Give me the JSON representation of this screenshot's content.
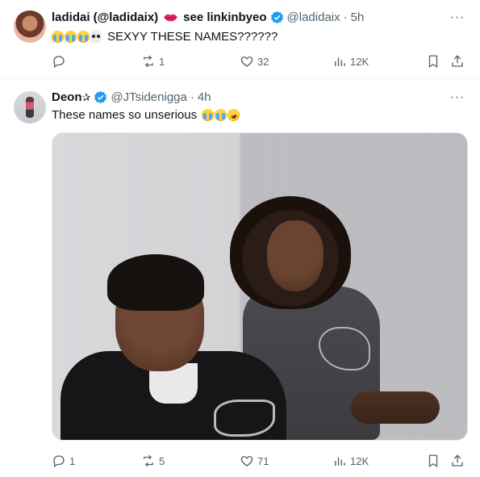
{
  "tweet1": {
    "display_name": "ladidai (@ladidaix)",
    "extra_name": "see linkinbyeo",
    "handle": "@ladidaix",
    "separator": "·",
    "time": "5h",
    "text": "SEXYY THESE NAMES??????",
    "emojis": [
      "crying-face",
      "crying-face",
      "crying-face",
      "skull"
    ],
    "more_label": "···",
    "actions": {
      "replies": "",
      "reposts": "1",
      "likes": "32",
      "views": "12K"
    }
  },
  "tweet2": {
    "display_name": "Deon",
    "name_suffix": "✰",
    "handle": "@JTsidenigga",
    "separator": "·",
    "time": "4h",
    "text": "These names so unserious",
    "emojis": [
      "crying-face",
      "crying-face",
      "rolling-laughing-face"
    ],
    "more_label": "···",
    "actions": {
      "replies": "1",
      "reposts": "5",
      "likes": "71",
      "views": "12K"
    }
  },
  "colors": {
    "text": "#0f1419",
    "secondary": "#536471",
    "verified": "#1d9bf0",
    "border": "#eff3f4"
  }
}
